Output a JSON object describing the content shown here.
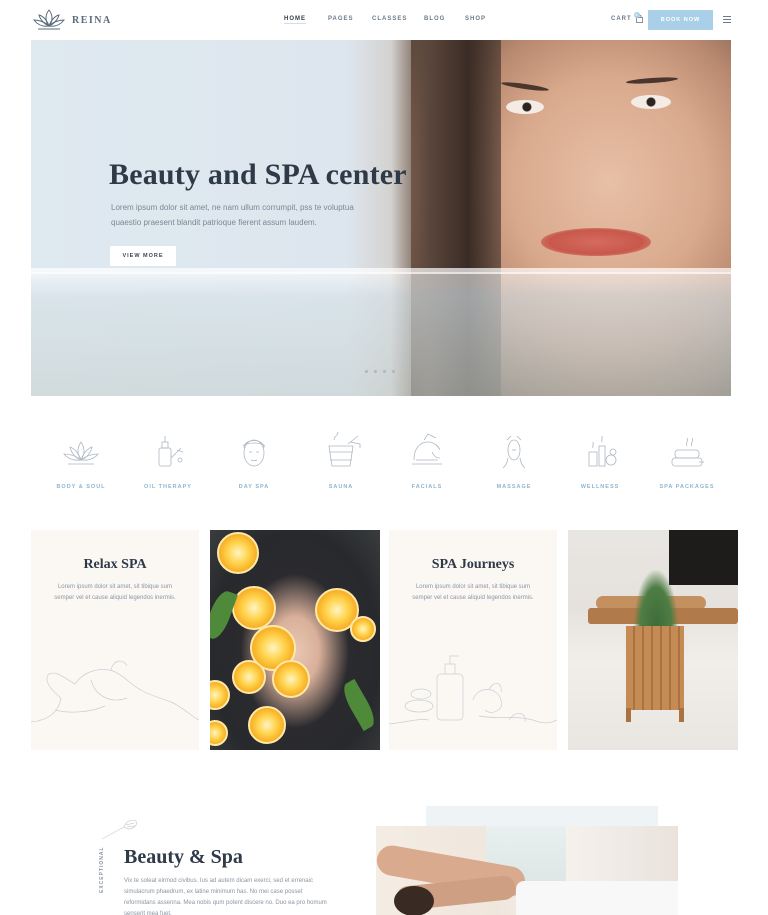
{
  "brand": {
    "name": "REINA"
  },
  "nav": {
    "items": [
      {
        "label": "HOME",
        "active": true
      },
      {
        "label": "PAGES"
      },
      {
        "label": "CLASSES"
      },
      {
        "label": "BLOG"
      },
      {
        "label": "SHOP"
      }
    ],
    "cart_label": "CART",
    "cart_count": "0",
    "book_label": "BOOK NOW"
  },
  "hero": {
    "title": "Beauty and SPA center",
    "text": "Lorem ipsum dolor sit amet, ne nam ullum corrumpit, pss te voluptua quaestio praesent blandit patrioque fierent assum laudem.",
    "button": "VIEW MORE",
    "slide_count": 4
  },
  "services": [
    {
      "label": "BODY & SOUL",
      "icon": "lotus-icon"
    },
    {
      "label": "OIL THERAPY",
      "icon": "oil-bottle-icon"
    },
    {
      "label": "DAY SPA",
      "icon": "face-towel-icon"
    },
    {
      "label": "SAUNA",
      "icon": "sauna-bucket-icon"
    },
    {
      "label": "FACIALS",
      "icon": "facial-icon"
    },
    {
      "label": "MASSAGE",
      "icon": "massage-icon"
    },
    {
      "label": "WELLNESS",
      "icon": "candles-icon"
    },
    {
      "label": "SPA PACKAGES",
      "icon": "towels-icon"
    }
  ],
  "cards": [
    {
      "title": "Relax SPA",
      "text": "Lorem ipsum dolor sit amet, sit tibique sum semper vel et cause aliquid legendos inermis."
    },
    {
      "title": "SPA Journeys",
      "text": "Lorem ipsum dolor sit amet, sit tibique sum semper vel et cause aliquid legendos inermis."
    }
  ],
  "about": {
    "vertical_label": "EXCEPTIONAL",
    "title": "Beauty & Spa",
    "text": "Vix te soleat eirmod civibus. Ius ad autem dicam exerci, sed et errenaic simulacrum phaedrum, ex latine minimum has. No mei case posset reformidans assenna. Mea nobis qum potent discere no. Duo ea pro homum senserit mea fuet."
  },
  "colors": {
    "accent": "#a9d0e8",
    "text_dark": "#2f3a48",
    "icon_label": "#8fb5cf",
    "card_bg": "#fbf8f4"
  }
}
